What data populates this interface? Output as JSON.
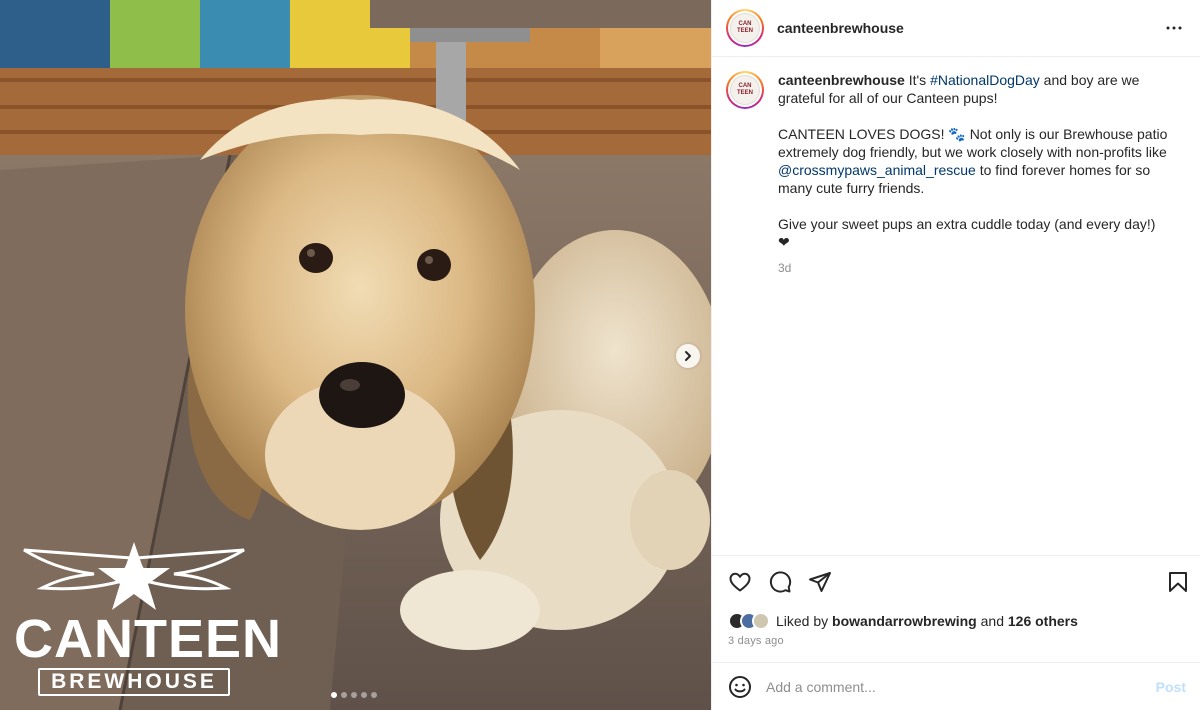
{
  "account": {
    "username": "canteenbrewhouse",
    "avatar_text": [
      "CAN",
      "TEEN"
    ]
  },
  "photo": {
    "logo_word": "CANTEEN",
    "logo_sub": "BREWHOUSE",
    "carousel": {
      "count": 5,
      "active_index": 0
    },
    "next_icon": "chevron-right-icon"
  },
  "header": {
    "username": "canteenbrewhouse",
    "more_icon": "more-horizontal-icon"
  },
  "caption": {
    "username": "canteenbrewhouse",
    "line1_pre": " It's ",
    "hashtag": "#NationalDogDay",
    "line1_post": " and boy are we grateful for all of our Canteen pups!",
    "para2_pre": "CANTEEN LOVES DOGS! 🐾 Not only is our Brewhouse patio extremely dog friendly, but we work closely with non-profits like ",
    "mention": "@crossmypaws_animal_rescue",
    "para2_post": " to find forever homes for so many cute furry friends.",
    "para3": "Give your sweet pups an extra cuddle today (and every day!) ❤",
    "age": "3d"
  },
  "actions": {
    "icons": [
      "heart-icon",
      "comment-icon",
      "share-icon",
      "bookmark-icon"
    ]
  },
  "likes": {
    "prefix": "Liked by ",
    "user": "bowandarrowbrewing",
    "middle": " and ",
    "others": "126 others"
  },
  "date": "3 days ago",
  "comment": {
    "placeholder": "Add a comment...",
    "post_label": "Post",
    "emoji_icon": "emoji-icon"
  },
  "colors": {
    "link": "#00376b",
    "muted": "#8e8e8e",
    "post_disabled": "#c0dffd"
  }
}
